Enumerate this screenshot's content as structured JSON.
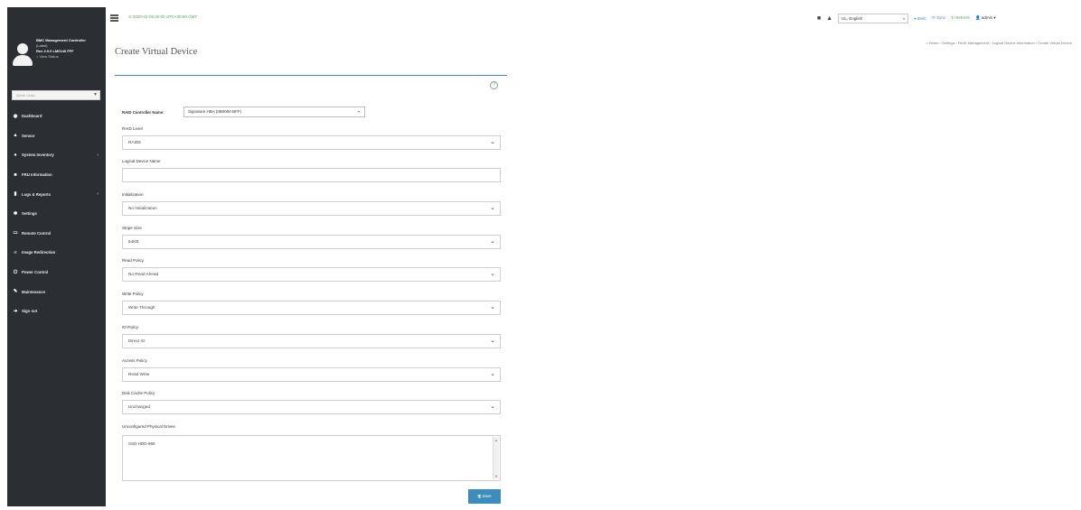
{
  "topbar": {
    "datetime": "⊙ 2020-02-06 00:00 UTC+00:00 GMT",
    "language": "UL, English",
    "bmc_label": "BMC",
    "sync_label": "Sync",
    "refresh_label": "Refresh",
    "user_label": "admin"
  },
  "sidebar": {
    "profile": {
      "line1": "BMC Management Controller",
      "line2": "(Label)",
      "line3": "Rev 2.0.0 LM0140 FFF",
      "line4": "○ View Status"
    },
    "search_placeholder": "Quick Links",
    "items": [
      {
        "label": "Dashboard",
        "icon": "dashboard-icon",
        "glyph": "◉",
        "has_arrow": false
      },
      {
        "label": "Sensor",
        "icon": "sensor-icon",
        "glyph": "▲",
        "has_arrow": false
      },
      {
        "label": "System Inventory",
        "icon": "inventory-icon",
        "glyph": "●",
        "has_arrow": true
      },
      {
        "label": "FRU Information",
        "icon": "fru-icon",
        "glyph": "■",
        "has_arrow": false
      },
      {
        "label": "Logs & Reports",
        "icon": "logs-icon",
        "glyph": "▮",
        "has_arrow": true
      },
      {
        "label": "Settings",
        "icon": "settings-icon",
        "glyph": "✱",
        "has_arrow": false
      },
      {
        "label": "Remote Control",
        "icon": "remote-control-icon",
        "glyph": "▭",
        "has_arrow": false
      },
      {
        "label": "Image Redirection",
        "icon": "image-redirection-icon",
        "glyph": "≡",
        "has_arrow": false
      },
      {
        "label": "Power Control",
        "icon": "power-icon",
        "glyph": "⏻",
        "has_arrow": false
      },
      {
        "label": "Maintenance",
        "icon": "wrench-icon",
        "glyph": "✎",
        "has_arrow": false
      },
      {
        "label": "Sign out",
        "icon": "sign-out-icon",
        "glyph": "➜",
        "has_arrow": false
      }
    ]
  },
  "page": {
    "title": "Create Virtual Device",
    "breadcrumb": "⌂ Home › Settings › RAID Management › Logical Device Information › Create Virtual Device"
  },
  "form": {
    "controller_label": "RAID Controller Name:",
    "controller_value": "Signature HBA (0B0000 BFF)",
    "fields": [
      {
        "label": "RAID Level",
        "value": "RAID5",
        "type": "select"
      },
      {
        "label": "Logical Device Name",
        "value": "",
        "type": "input"
      },
      {
        "label": "Initialization",
        "value": "No Initialization",
        "type": "select"
      },
      {
        "label": "Stripe Size",
        "value": "64KB",
        "type": "select"
      },
      {
        "label": "Read Policy",
        "value": "No Read Ahead",
        "type": "select"
      },
      {
        "label": "Write Policy",
        "value": "Write Through",
        "type": "select"
      },
      {
        "label": "IO Policy",
        "value": "Direct IO",
        "type": "select"
      },
      {
        "label": "Access Policy",
        "value": "Read Write",
        "type": "select"
      },
      {
        "label": "Disk Cache Policy",
        "value": "Unchanged",
        "type": "select"
      }
    ],
    "drives_label": "Unconfigured Physical Drives",
    "drives_value": "SSD-HDD-968",
    "save_label": "Save"
  },
  "colors": {
    "sidebar_bg": "#2b2f33",
    "accent": "#3c8dbc",
    "datetime_green": "#5aa35a"
  }
}
